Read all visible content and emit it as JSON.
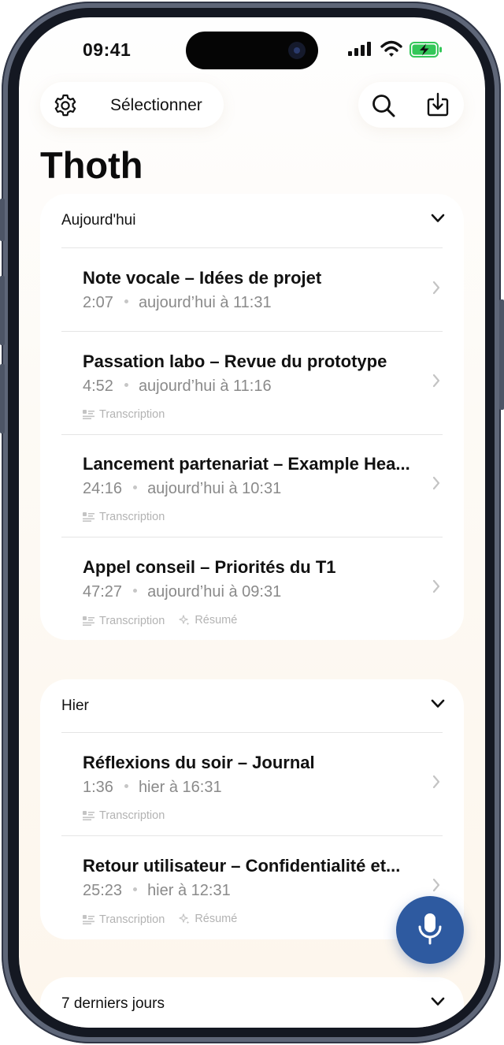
{
  "status_bar": {
    "time": "09:41"
  },
  "toolbar": {
    "select_label": "Sélectionner"
  },
  "page": {
    "title": "Thoth"
  },
  "sections": [
    {
      "header": "Aujourd'hui",
      "items": [
        {
          "title": "Note vocale – Idées de projet",
          "duration": "2:07",
          "when": "aujourd’hui à 11:31",
          "tags": []
        },
        {
          "title": "Passation labo – Revue du prototype",
          "duration": "4:52",
          "when": "aujourd’hui à 11:16",
          "tags": [
            "Transcription"
          ]
        },
        {
          "title": "Lancement partenariat – Example Hea...",
          "duration": "24:16",
          "when": "aujourd’hui à 10:31",
          "tags": [
            "Transcription"
          ]
        },
        {
          "title": "Appel conseil – Priorités du T1",
          "duration": "47:27",
          "when": "aujourd’hui à 09:31",
          "tags": [
            "Transcription",
            "Résumé"
          ]
        }
      ]
    },
    {
      "header": "Hier",
      "items": [
        {
          "title": "Réflexions du soir – Journal",
          "duration": "1:36",
          "when": "hier à 16:31",
          "tags": [
            "Transcription"
          ]
        },
        {
          "title": "Retour utilisateur – Confidentialité et...",
          "duration": "25:23",
          "when": "hier à 12:31",
          "tags": [
            "Transcription",
            "Résumé"
          ]
        }
      ]
    },
    {
      "header": "7 derniers jours",
      "items": []
    }
  ],
  "icons": {
    "settings": "gear-icon",
    "search": "search-icon",
    "import": "download-icon",
    "expand": "chevron-down-icon",
    "open": "chevron-right-icon",
    "transcription": "transcript-icon",
    "summary": "sparkle-icon",
    "record": "microphone-icon"
  },
  "colors": {
    "accent": "#2e5aa0",
    "battery": "#34c759",
    "muted_text": "#8a8a8a"
  }
}
